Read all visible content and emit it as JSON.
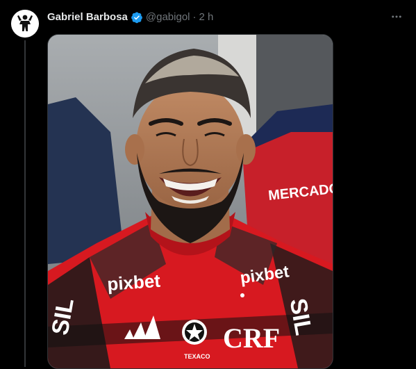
{
  "tweet": {
    "author_name": "Gabriel Barbosa",
    "handle": "@gabigol",
    "separator": "·",
    "time": "2 h",
    "verified": true,
    "more_icon": "more-horizontal-icon",
    "avatar_icon": "silhouette-avatar-icon"
  },
  "media": {
    "jersey_sponsor_left": "pixbet",
    "jersey_sponsor_right": "pixbet",
    "sleeve_text_left": "SIL",
    "sleeve_text_right": "SIL",
    "sponsor_badge": "TEXACO",
    "background_banner": "MERCADO LIVRE",
    "crest_letters": "CRF"
  },
  "colors": {
    "background": "#000000",
    "text_primary": "#e7e9ea",
    "text_secondary": "#71767b",
    "verified_blue": "#1d9bf0",
    "jersey_red": "#d71920"
  }
}
